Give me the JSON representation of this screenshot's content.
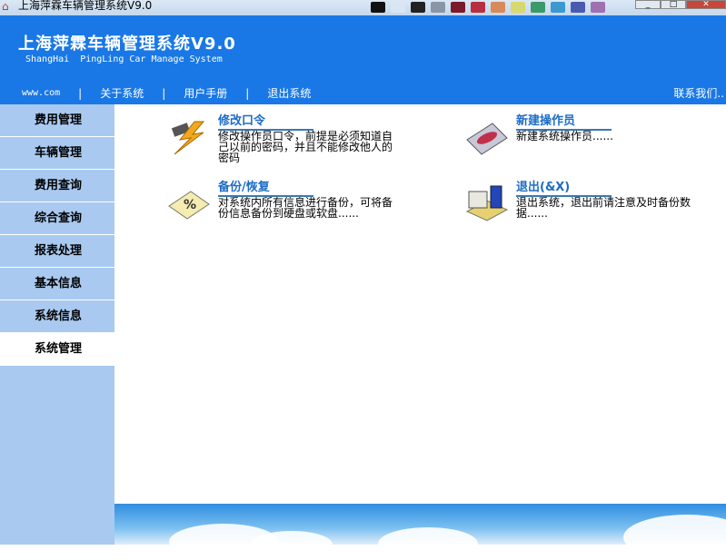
{
  "window": {
    "title": "上海萍霖车辆管理系统V9.0",
    "palette": [
      "#111",
      "#d8e6f4",
      "#222",
      "#8a96a6",
      "#7a1a2a",
      "#b83040",
      "#d88a5a",
      "#d8d870",
      "#3a9a6a",
      "#3a9ad0",
      "#4a5ab0",
      "#a070b0"
    ]
  },
  "header": {
    "title": "上海萍霖车辆管理系统V9.0",
    "subtitle": "ShangHai  PingLing Car Manage System",
    "nav": {
      "www": "www.com",
      "sep": "|",
      "about": "关于系统",
      "manual": "用户手册",
      "exit": "退出系统"
    },
    "contact": "联系我们.."
  },
  "sidebar": {
    "items": [
      {
        "label": "费用管理"
      },
      {
        "label": "车辆管理"
      },
      {
        "label": "费用查询"
      },
      {
        "label": "综合查询"
      },
      {
        "label": "报表处理"
      },
      {
        "label": "基本信息"
      },
      {
        "label": "系统信息"
      },
      {
        "label": "系统管理"
      }
    ],
    "active": 7
  },
  "cards": [
    {
      "title": "修改口令",
      "desc": "修改操作员口令，前提是必须知道自己以前的密码，并且不能修改他人的密码"
    },
    {
      "title": "新建操作员",
      "desc": "新建系统操作员......"
    },
    {
      "title": "备份/恢复",
      "desc": "对系统内所有信息进行备份，可将备份信息备份到硬盘或软盘......"
    },
    {
      "title": "退出(&X)",
      "desc": "退出系统，退出前请注意及时备份数据......"
    }
  ]
}
